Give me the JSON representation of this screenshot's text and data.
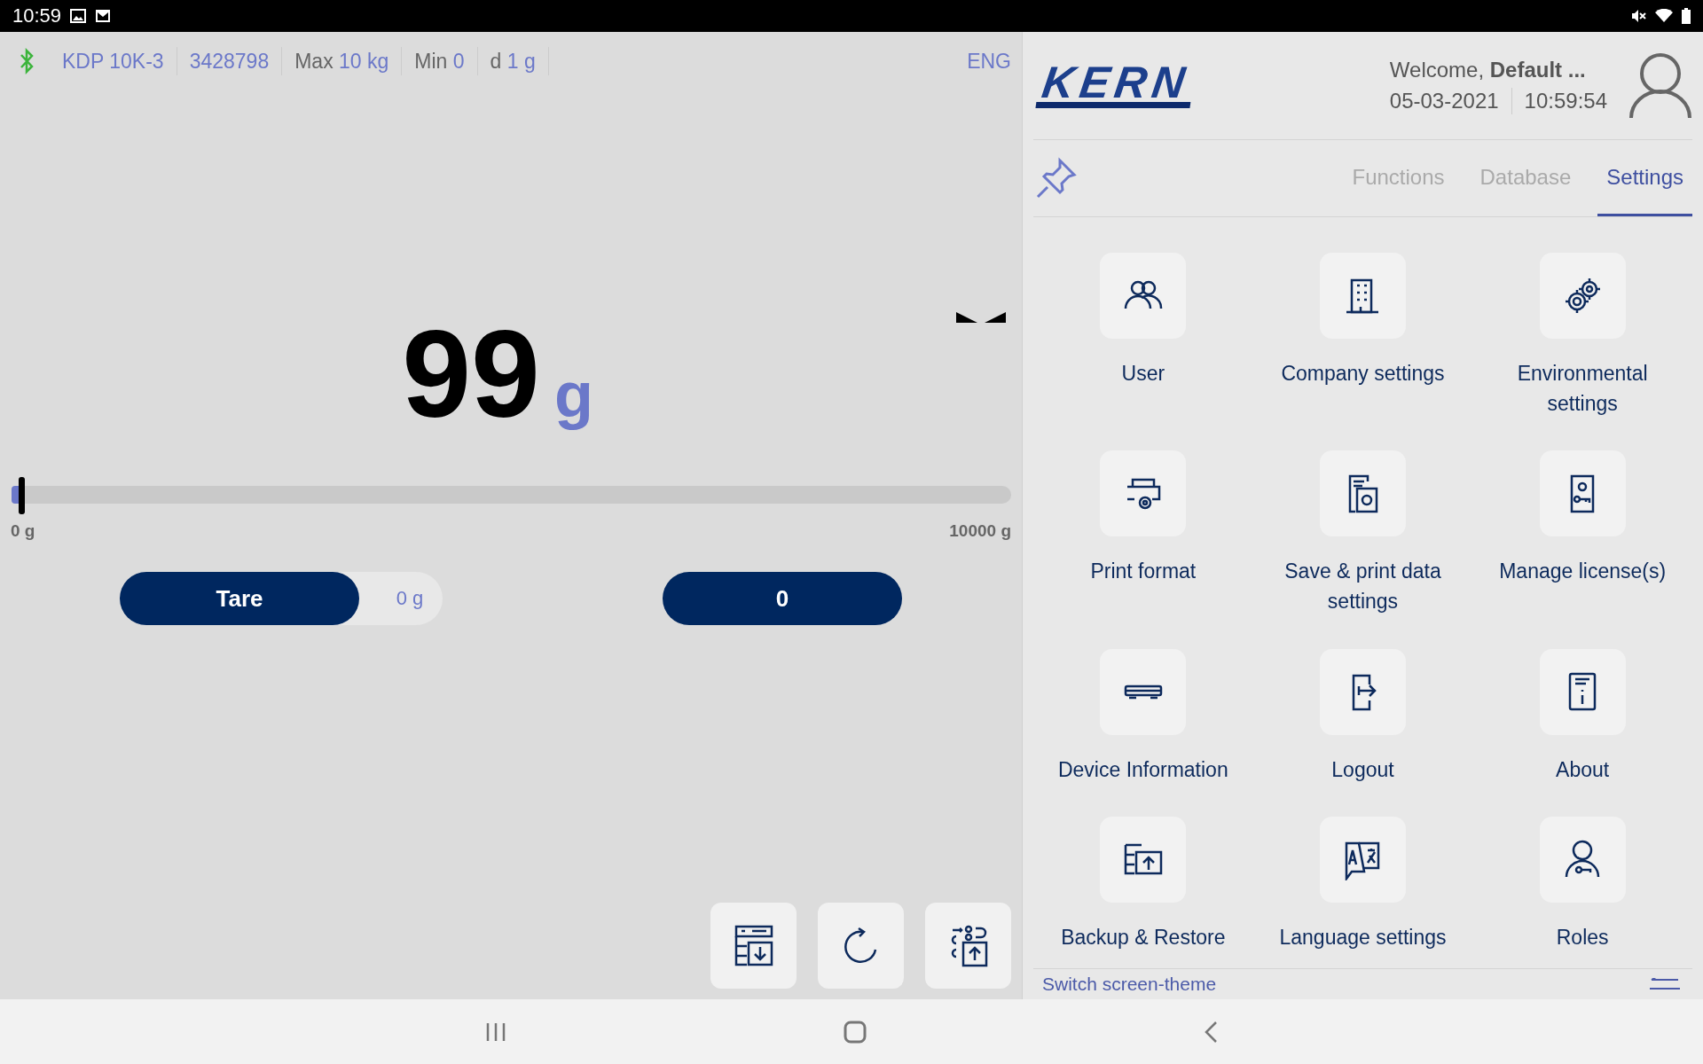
{
  "status_bar": {
    "time": "10:59"
  },
  "scale_info": [
    {
      "value": "KDP 10K-3"
    },
    {
      "value": "3428798"
    },
    {
      "label": "Max",
      "value": "10 kg"
    },
    {
      "label": "Min",
      "value": "0"
    },
    {
      "label": "d",
      "value": "1 g"
    }
  ],
  "language": "ENG",
  "weight": {
    "value": "99",
    "unit": "g"
  },
  "capacity": {
    "level": 0.01,
    "min_label": "0 g",
    "max_label": "10000 g"
  },
  "tare": {
    "label": "Tare",
    "value": "0 g"
  },
  "zero_button": "0",
  "logo": "KERN",
  "header": {
    "welcome": "Welcome,",
    "user": "Default ...",
    "date": "05-03-2021",
    "time": "10:59:54"
  },
  "tabs": [
    {
      "label": "Functions",
      "selected": false
    },
    {
      "label": "Database",
      "selected": false
    },
    {
      "label": "Settings",
      "selected": true
    }
  ],
  "settings": [
    {
      "label": "User"
    },
    {
      "label": "Company settings"
    },
    {
      "label": "Environmental settings"
    },
    {
      "label": "Print format"
    },
    {
      "label": "Save & print data settings"
    },
    {
      "label": "Manage license(s)"
    },
    {
      "label": "Device Information"
    },
    {
      "label": "Logout"
    },
    {
      "label": "About"
    },
    {
      "label": "Backup & Restore"
    },
    {
      "label": "Language settings"
    },
    {
      "label": "Roles"
    }
  ],
  "footer_link": "Switch screen-theme"
}
